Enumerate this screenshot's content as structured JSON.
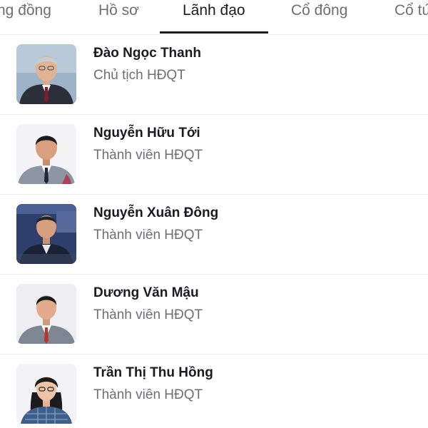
{
  "tabs": [
    {
      "label": "ng đồng",
      "active": false
    },
    {
      "label": "Hồ sơ",
      "active": false
    },
    {
      "label": "Lãnh đạo",
      "active": true
    },
    {
      "label": "Cổ đông",
      "active": false
    },
    {
      "label": "Cổ tứ",
      "active": false
    }
  ],
  "leaders": [
    {
      "name": "Đào Ngọc Thanh",
      "role": "Chủ tịch HĐQT"
    },
    {
      "name": "Nguyễn Hữu Tới",
      "role": "Thành viên HĐQT"
    },
    {
      "name": "Nguyễn Xuân Đông",
      "role": "Thành viên HĐQT"
    },
    {
      "name": "Dương Văn Mậu",
      "role": "Thành viên HĐQT"
    },
    {
      "name": "Trần Thị Thu Hồng",
      "role": "Thành viên HĐQT"
    }
  ],
  "colors": {
    "active_tab": "#1c1c1e",
    "inactive_tab": "#6e6e73",
    "divider": "#ececec"
  }
}
